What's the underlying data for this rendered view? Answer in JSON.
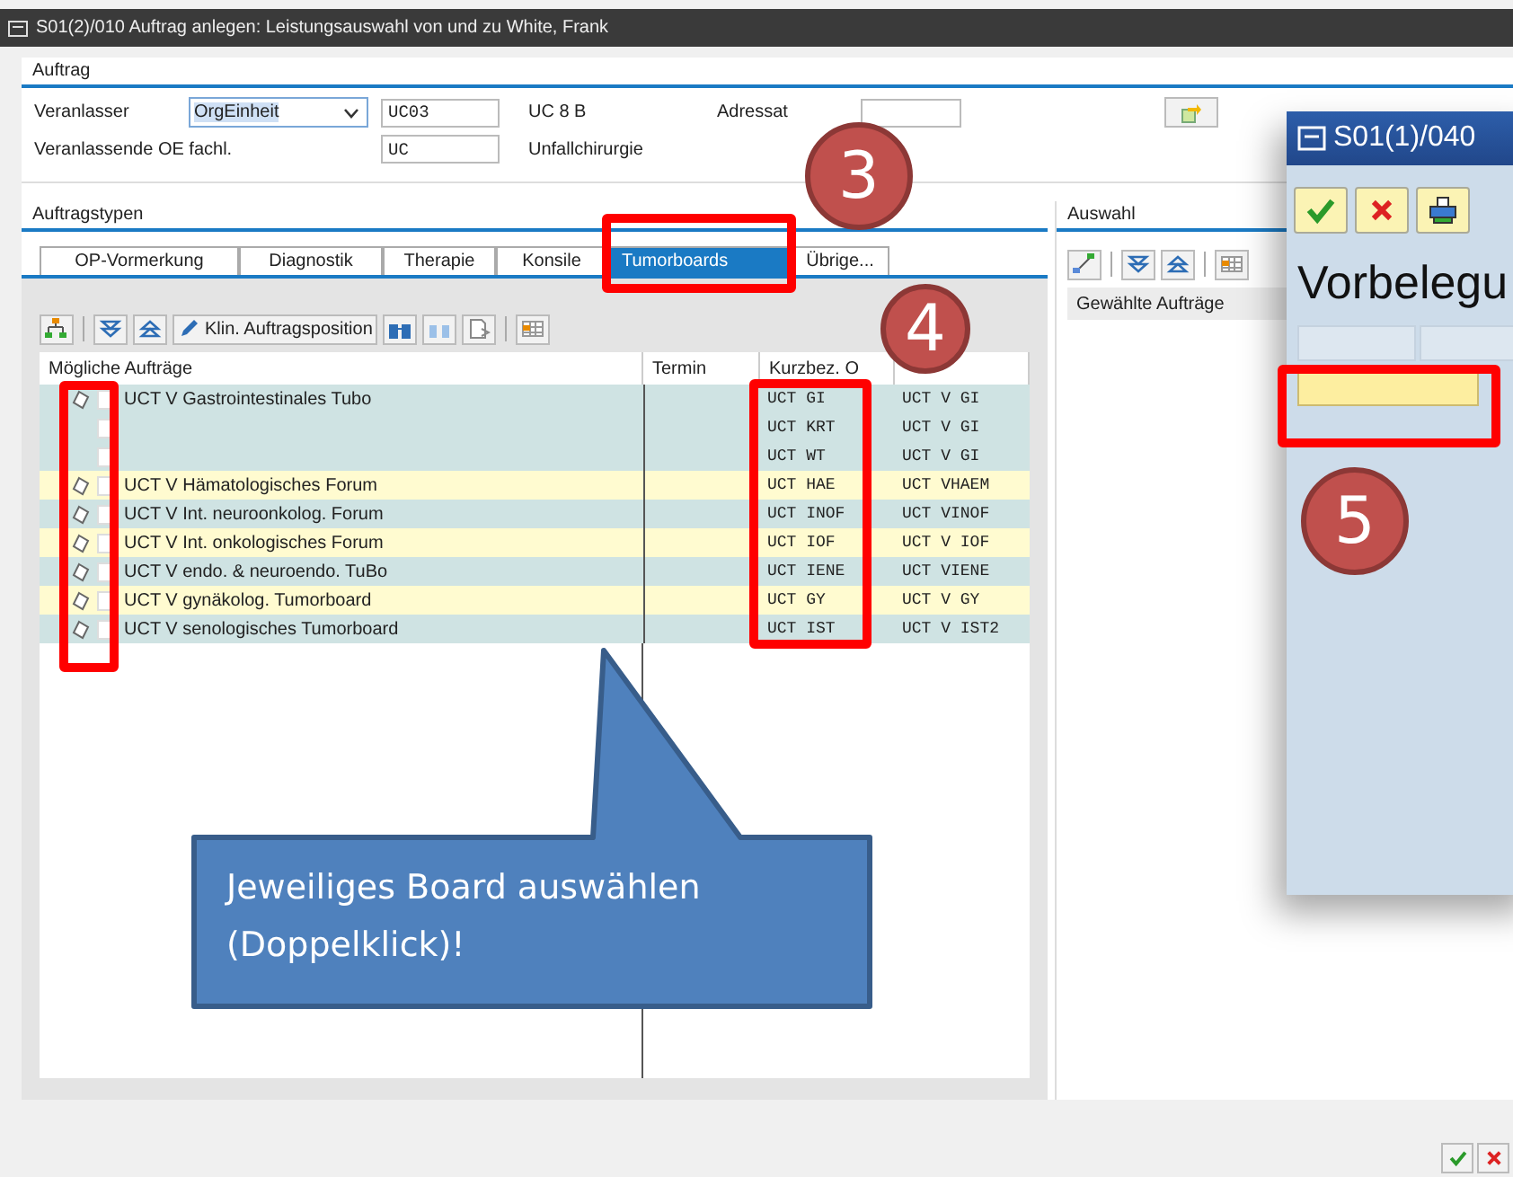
{
  "window": {
    "title": "S01(2)/010 Auftrag anlegen: Leistungsauswahl von und zu White, Frank"
  },
  "auftrag": {
    "title": "Auftrag",
    "veranlasser_label": "Veranlasser",
    "veranlasser_value": "OrgEinheit",
    "code_value": "UC03",
    "code_text": "UC 8 B",
    "adressat_label": "Adressat",
    "oe_label": "Veranlassende OE fachl.",
    "oe_value": "UC",
    "oe_text": "Unfallchirurgie"
  },
  "auftragstypen": {
    "title": "Auftragstypen",
    "tabs": [
      {
        "label": "OP-Vormerkung",
        "selected": false
      },
      {
        "label": "Diagnostik",
        "selected": false
      },
      {
        "label": "Therapie",
        "selected": false
      },
      {
        "label": "Konsile",
        "selected": false
      },
      {
        "label": "Tumorboards",
        "selected": true
      },
      {
        "label": "Übrige...",
        "selected": false
      }
    ],
    "toolbar_button": "Klin. Auftragsposition",
    "columns": [
      "Mögliche Aufträge",
      "Termin",
      "Kurzbez. O"
    ],
    "rows": [
      {
        "kind": "order",
        "name": "UCT V Gastrointestinales Tubo",
        "code": "UCT GI",
        "column_4": "UCT V GI",
        "color": "#cfe3e3"
      },
      {
        "kind": "variant",
        "code": "UCT KRT",
        "column_4": "UCT V GI",
        "color": "#cfe3e3"
      },
      {
        "kind": "variant",
        "code": "UCT WT",
        "column_4": "UCT V GI",
        "color": "#cfe3e3"
      },
      {
        "kind": "order",
        "name": "UCT V Hämatologisches Forum",
        "code": "UCT HAE",
        "column_4": "UCT VHAEM",
        "color": "#fffbd0"
      },
      {
        "kind": "order",
        "name": "UCT V Int. neuroonkolog. Forum",
        "code": "UCT INOF",
        "column_4": "UCT VINOF",
        "color": "#cfe3e3"
      },
      {
        "kind": "order",
        "name": "UCT V Int. onkologisches Forum",
        "code": "UCT IOF",
        "column_4": "UCT V IOF",
        "color": "#fffbd0"
      },
      {
        "kind": "order",
        "name": "UCT V endo. & neuroendo. TuBo",
        "code": "UCT IENE",
        "column_4": "UCT VIENE",
        "color": "#cfe3e3"
      },
      {
        "kind": "order",
        "name": "UCT V gynäkolog. Tumorboard",
        "code": "UCT GY",
        "column_4": "UCT V GY",
        "color": "#fffbd0"
      },
      {
        "kind": "order",
        "name": "UCT V senologisches Tumorboard",
        "code": "UCT IST",
        "column_4": "UCT V IST2",
        "color": "#cfe3e3"
      }
    ]
  },
  "auswahl": {
    "title": "Auswahl",
    "column": "Gewählte Aufträge"
  },
  "popup": {
    "title": "S01(1)/040",
    "heading": "Vorbelegu"
  },
  "annotations": {
    "badges": [
      "3",
      "4",
      "5"
    ],
    "callout": "Jeweiliges Board auswählen (Doppelklick)!"
  }
}
